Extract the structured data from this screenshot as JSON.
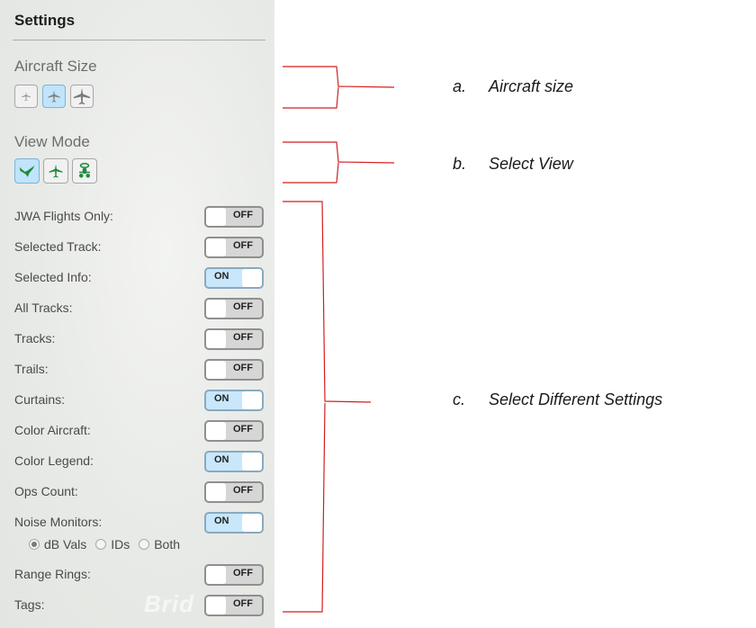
{
  "settings": {
    "title": "Settings",
    "aircraft_size": {
      "label": "Aircraft Size",
      "buttons": [
        {
          "name": "small",
          "icon": "small-plane-icon",
          "active": false
        },
        {
          "name": "medium",
          "icon": "medium-plane-icon",
          "active": true
        },
        {
          "name": "large",
          "icon": "large-plane-icon",
          "active": false
        }
      ]
    },
    "view_mode": {
      "label": "View Mode",
      "buttons": [
        {
          "name": "perspective",
          "icon": "angled-view-icon",
          "active": true
        },
        {
          "name": "top",
          "icon": "top-view-icon",
          "active": false
        },
        {
          "name": "front",
          "icon": "front-view-icon",
          "active": false
        }
      ]
    },
    "toggles": [
      {
        "label": "JWA Flights Only:",
        "state": "OFF"
      },
      {
        "label": "Selected Track:",
        "state": "OFF"
      },
      {
        "label": "Selected Info:",
        "state": "ON"
      },
      {
        "label": "All Tracks:",
        "state": "OFF"
      },
      {
        "label": "Tracks:",
        "state": "OFF"
      },
      {
        "label": "Trails:",
        "state": "OFF"
      },
      {
        "label": "Curtains:",
        "state": "ON"
      },
      {
        "label": "Color Aircraft:",
        "state": "OFF"
      },
      {
        "label": "Color Legend:",
        "state": "ON"
      },
      {
        "label": "Ops Count:",
        "state": "OFF"
      },
      {
        "label": "Noise Monitors:",
        "state": "ON"
      },
      {
        "label": "Range Rings:",
        "state": "OFF"
      },
      {
        "label": "Tags:",
        "state": "OFF"
      }
    ],
    "noise_options": {
      "options": [
        "dB Vals",
        "IDs",
        "Both"
      ],
      "selected": "dB Vals"
    },
    "watermark": "Brid"
  },
  "annotations": [
    {
      "letter": "a.",
      "text": "Aircraft size"
    },
    {
      "letter": "b.",
      "text": "Select View"
    },
    {
      "letter": "c.",
      "text": "Select Different Settings"
    }
  ],
  "colors": {
    "annotation_bracket": "#d21f1f",
    "active_button": "#bfe4fb",
    "view_icon_green": "#1f8a3e"
  }
}
